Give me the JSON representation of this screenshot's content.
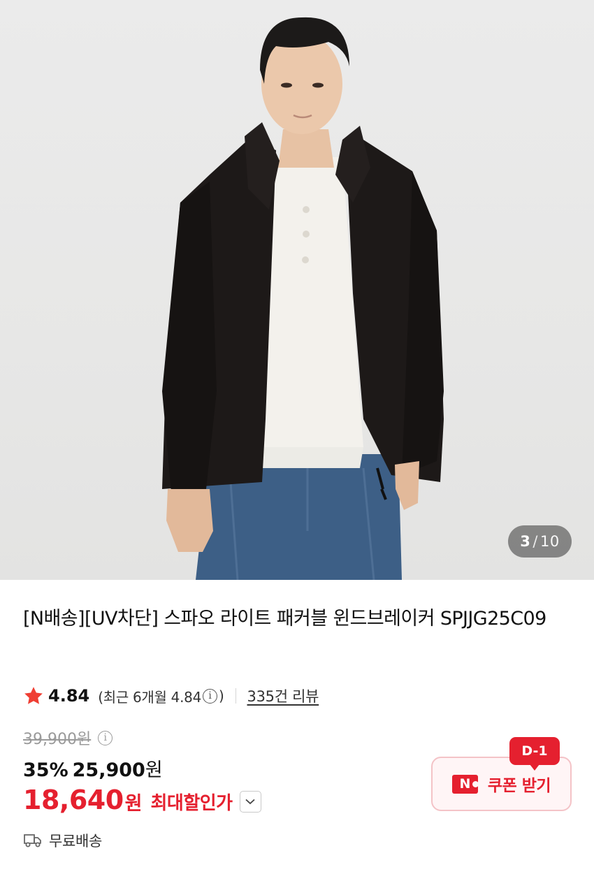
{
  "gallery": {
    "current": "3",
    "separator": "/",
    "total": "10"
  },
  "product": {
    "title": "[N배송][UV차단] 스파오 라이트 패커블 윈드브레이커 SPJJG25C09"
  },
  "rating": {
    "score": "4.84",
    "recent_prefix": "(최근 6개월 4.84",
    "recent_suffix": ")",
    "review_count": "335건 리뷰",
    "star_color": "#ef3e33"
  },
  "price": {
    "original": "39,900원",
    "discount_percent": "35%",
    "sale_amount": "25,900",
    "sale_unit": "원",
    "max_amount": "18,640",
    "max_unit": "원",
    "max_label": "최대할인가",
    "accent_color": "#e5202f"
  },
  "coupon": {
    "badge": "D-1",
    "n_logo": "N",
    "label": "쿠폰 받기"
  },
  "shipping": {
    "label": "무료배송",
    "icon": "truck-icon"
  }
}
